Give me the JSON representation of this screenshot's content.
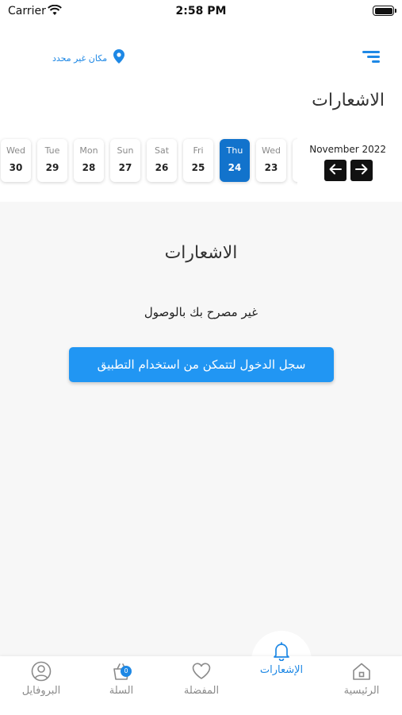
{
  "status_bar": {
    "carrier": "Carrier",
    "time": "2:58 PM"
  },
  "header": {
    "location": "مكان غير محدد",
    "title": "الاشعارات"
  },
  "calendar": {
    "month": "November 2022",
    "days": [
      {
        "name": "Wed",
        "date": "30"
      },
      {
        "name": "Tue",
        "date": "29"
      },
      {
        "name": "Mon",
        "date": "28"
      },
      {
        "name": "Sun",
        "date": "27"
      },
      {
        "name": "Sat",
        "date": "26"
      },
      {
        "name": "Fri",
        "date": "25"
      },
      {
        "name": "Thu",
        "date": "24"
      },
      {
        "name": "Wed",
        "date": "23"
      }
    ],
    "selected_date": "24"
  },
  "content": {
    "title": "الاشعارات",
    "message": "غير مصرح بك بالوصول",
    "login_button": "سجل الدخول لتتمكن من استخدام التطبيق"
  },
  "bottom_nav": {
    "items": [
      {
        "label": "البروفايل",
        "icon": "profile-icon"
      },
      {
        "label": "السلة",
        "icon": "cart-icon",
        "badge": "0"
      },
      {
        "label": "المفضلة",
        "icon": "heart-icon"
      },
      {
        "label": "الإشعارات",
        "icon": "bell-icon"
      },
      {
        "label": "الرئيسية",
        "icon": "home-icon"
      }
    ],
    "active": "الإشعارات"
  },
  "colors": {
    "accent": "#1e88e5",
    "selected_day": "#1273cc",
    "button": "#2196f3"
  }
}
